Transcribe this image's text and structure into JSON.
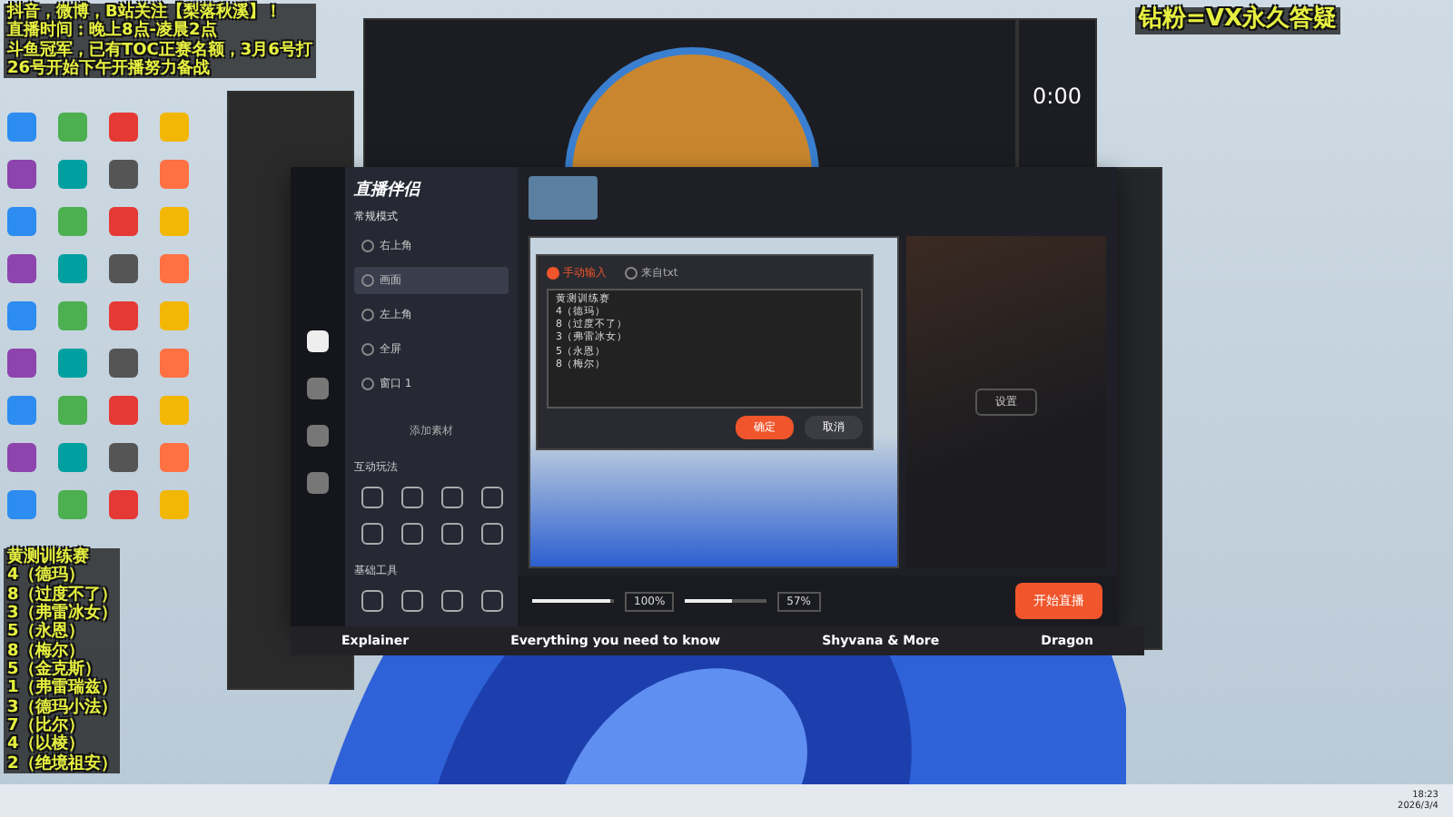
{
  "overlay_top_left": [
    "抖音，微博，B站关注【梨落秋溪】！",
    "直播时间：晚上8点-凌晨2点",
    "斗鱼冠军，已有TOC正赛名额，3月6号打",
    "26号开始下午开播努力备战"
  ],
  "overlay_top_right": "钻粉=VX永久答疑",
  "overlay_list": {
    "title": "黄测训练赛",
    "items": [
      "4（德玛）",
      "8（过度不了）",
      "3（弗雷冰女）",
      "5（永恩）",
      "8（梅尔）",
      "5（金克斯）",
      "1（弗雷瑞兹）",
      "3（德玛小法）",
      "7（比尔）",
      "4（以棱）",
      "2（绝境祖安）"
    ]
  },
  "app": {
    "title": "直播伴侣",
    "mode": "常规模式",
    "scenes": [
      {
        "label": "右上角",
        "selected": false
      },
      {
        "label": "画面",
        "selected": true
      },
      {
        "label": "左上角",
        "selected": false
      },
      {
        "label": "全屏",
        "selected": false
      },
      {
        "label": "窗口 1",
        "selected": false
      }
    ],
    "add_source": "添加素材",
    "sections": [
      "互动玩法",
      "基础工具"
    ],
    "mic": {
      "level": 0.95,
      "reading": "100%"
    },
    "speaker": {
      "level": 0.57,
      "reading": "57%"
    },
    "start_button": "开始直播",
    "settings_button": "设置"
  },
  "dialog": {
    "tabs": [
      {
        "label": "手动输入",
        "selected": true
      },
      {
        "label": "来自txt",
        "selected": false
      }
    ],
    "text_lines": [
      "黄测训练赛",
      "4（德玛）",
      "8（过度不了）",
      "3（弗雷冰女）",
      "5（永恩）",
      "8（梅尔）"
    ],
    "buttons": [
      {
        "label": "确定",
        "kind": "primary"
      },
      {
        "label": "取消",
        "kind": "secondary"
      }
    ]
  },
  "game_labels": [
    "Explainer",
    "Everything you need to know",
    "Shyvana & More",
    "Dragon"
  ],
  "timer": "0:00",
  "taskbar": {
    "time": "18:23",
    "date": "2026/3/4"
  }
}
